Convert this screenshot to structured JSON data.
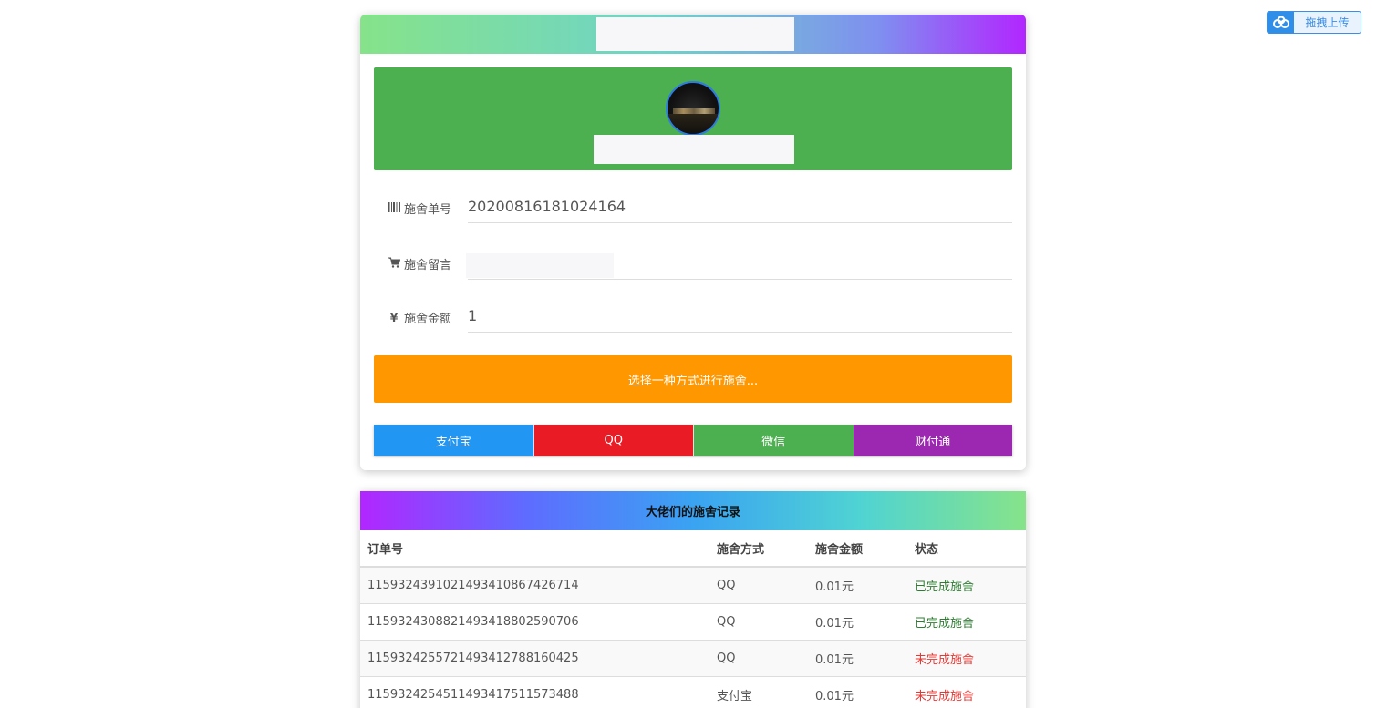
{
  "upload_widget": {
    "label": "拖拽上传",
    "icon": "baidu-cloud-icon",
    "color": "#3a8ee6"
  },
  "form": {
    "order_no": {
      "label": "施舍单号",
      "icon": "barcode-icon",
      "value": "20200816181024164"
    },
    "message": {
      "label": "施舍留言",
      "icon": "cart-icon",
      "value": ""
    },
    "amount": {
      "label": "施舍金额",
      "icon": "yen-icon",
      "value": "1"
    }
  },
  "prompt": "选择一种方式进行施舍...",
  "payment_methods": [
    {
      "label": "支付宝",
      "color": "#2196f3"
    },
    {
      "label": "QQ",
      "color": "#e91b24"
    },
    {
      "label": "微信",
      "color": "#4caf50"
    },
    {
      "label": "财付通",
      "color": "#9c27b0"
    }
  ],
  "records": {
    "title": "大佬们的施舍记录",
    "columns": [
      "订单号",
      "施舍方式",
      "施舍金额",
      "状态"
    ],
    "rows": [
      {
        "order": "1159324391021493410867426714",
        "method": "QQ",
        "amount": "0.01元",
        "status": "已完成施舍"
      },
      {
        "order": "1159324308821493418802590706",
        "method": "QQ",
        "amount": "0.01元",
        "status": "已完成施舍"
      },
      {
        "order": "1159324255721493412788160425",
        "method": "QQ",
        "amount": "0.01元",
        "status": "未完成施舍"
      },
      {
        "order": "1159324254511493417511573488",
        "method": "支付宝",
        "amount": "0.01元",
        "status": "未完成施舍"
      }
    ]
  }
}
